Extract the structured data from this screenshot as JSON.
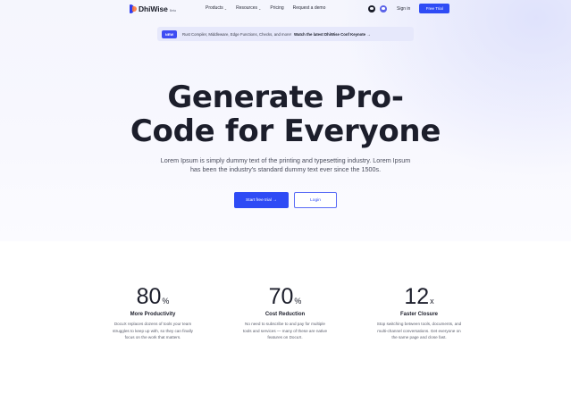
{
  "nav": {
    "logo_text": "DhiWise",
    "logo_tag": "Beta",
    "menu": [
      {
        "label": "Products",
        "has_dropdown": true
      },
      {
        "label": "Resources",
        "has_dropdown": true
      },
      {
        "label": "Pricing",
        "has_dropdown": false
      },
      {
        "label": "Request a demo",
        "has_dropdown": false
      }
    ],
    "icons": [
      "github-icon",
      "discord-icon"
    ],
    "signin_label": "Sign in",
    "free_trial_label": "Free Trial"
  },
  "announcement": {
    "badge": "NEW",
    "text": "Rust Compiler, Middleware, Edge Functions, Checks, and more!",
    "link": "Watch the latest DhiWise Conf Keynote →"
  },
  "hero": {
    "headline_line1": "Generate Pro-",
    "headline_line2": "Code for Everyone",
    "subtext_line1": "Lorem Ipsum is simply dummy text of the printing and typesetting industry. Lorem Ipsum",
    "subtext_line2": "has been the industry's standard dummy text ever since the 1500s.",
    "primary_cta": "Start free trial  →",
    "secondary_cta": "Login"
  },
  "stats": [
    {
      "value": "80",
      "unit": "%",
      "title": "More Productivity",
      "desc_lines": [
        "DocuX replaces dozens of tools your team",
        "struggles to keep up with, so they can finally",
        "focus on the work that matters."
      ]
    },
    {
      "value": "70",
      "unit": "%",
      "title": "Cost Reduction",
      "desc_lines": [
        "No need to subscribe to and pay for multiple",
        "tools and services — many of these are native",
        "features on DocuX."
      ]
    },
    {
      "value": "12",
      "unit": "x",
      "title": "Faster Closure",
      "desc_lines": [
        "Stop switching between tools, documents, and",
        "multi-channel conversations. Get everyone on",
        "the same page and close fast."
      ]
    }
  ],
  "colors": {
    "accent": "#2e4bf5",
    "text_dark": "#1c1e2b",
    "hero_bg": "#f5f6fd",
    "announcement_bg": "#e6e8fb"
  }
}
